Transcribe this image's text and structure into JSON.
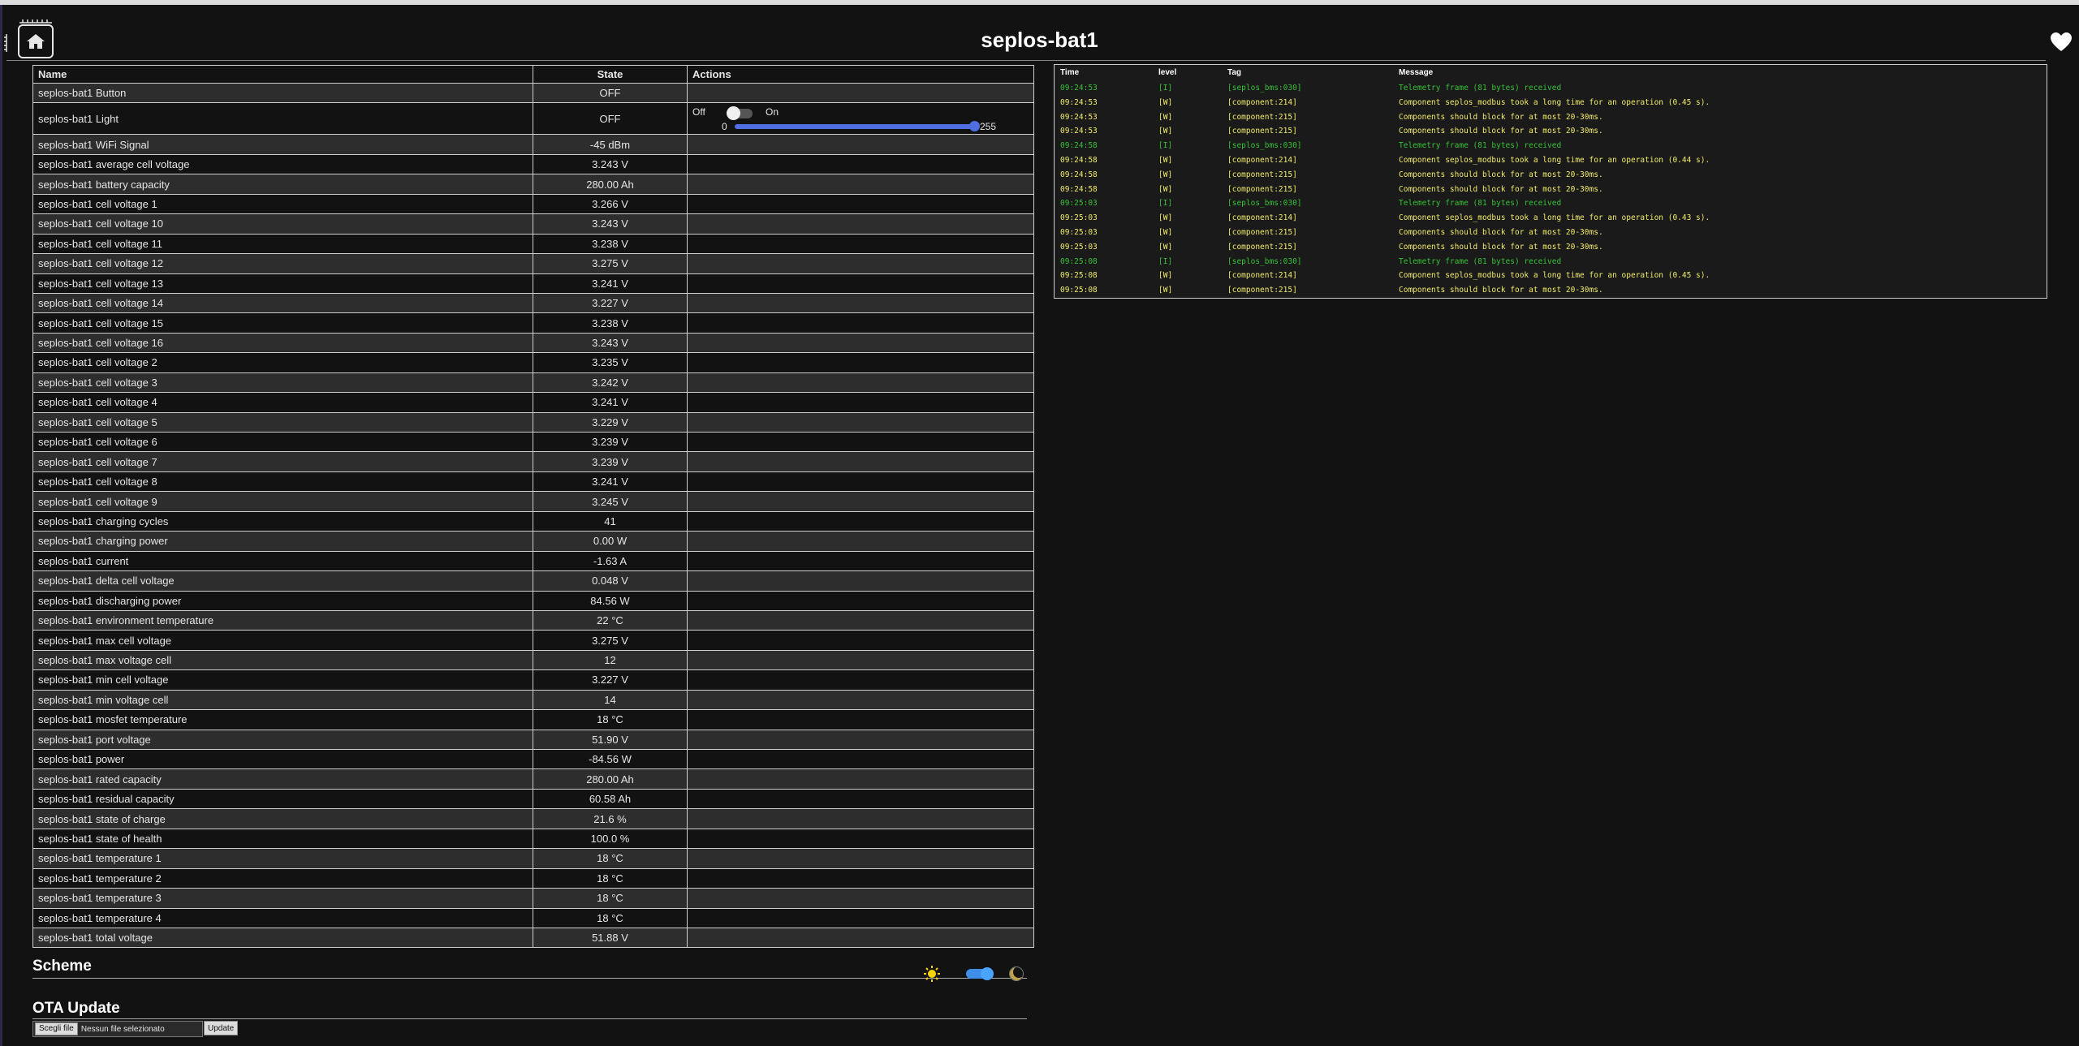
{
  "page": {
    "title": "seplos-bat1"
  },
  "table": {
    "headers": [
      "Name",
      "State",
      "Actions"
    ],
    "rows": [
      {
        "name": "seplos-bat1 Button",
        "state": "OFF"
      },
      {
        "name": "seplos-bat1 Light",
        "state": "OFF"
      },
      {
        "name": "seplos-bat1 WiFi Signal",
        "state": "-45 dBm"
      },
      {
        "name": "seplos-bat1 average cell voltage",
        "state": "3.243 V"
      },
      {
        "name": "seplos-bat1 battery capacity",
        "state": "280.00 Ah"
      },
      {
        "name": "seplos-bat1 cell voltage 1",
        "state": "3.266 V"
      },
      {
        "name": "seplos-bat1 cell voltage 10",
        "state": "3.243 V"
      },
      {
        "name": "seplos-bat1 cell voltage 11",
        "state": "3.238 V"
      },
      {
        "name": "seplos-bat1 cell voltage 12",
        "state": "3.275 V"
      },
      {
        "name": "seplos-bat1 cell voltage 13",
        "state": "3.241 V"
      },
      {
        "name": "seplos-bat1 cell voltage 14",
        "state": "3.227 V"
      },
      {
        "name": "seplos-bat1 cell voltage 15",
        "state": "3.238 V"
      },
      {
        "name": "seplos-bat1 cell voltage 16",
        "state": "3.243 V"
      },
      {
        "name": "seplos-bat1 cell voltage 2",
        "state": "3.235 V"
      },
      {
        "name": "seplos-bat1 cell voltage 3",
        "state": "3.242 V"
      },
      {
        "name": "seplos-bat1 cell voltage 4",
        "state": "3.241 V"
      },
      {
        "name": "seplos-bat1 cell voltage 5",
        "state": "3.229 V"
      },
      {
        "name": "seplos-bat1 cell voltage 6",
        "state": "3.239 V"
      },
      {
        "name": "seplos-bat1 cell voltage 7",
        "state": "3.239 V"
      },
      {
        "name": "seplos-bat1 cell voltage 8",
        "state": "3.241 V"
      },
      {
        "name": "seplos-bat1 cell voltage 9",
        "state": "3.245 V"
      },
      {
        "name": "seplos-bat1 charging cycles",
        "state": "41"
      },
      {
        "name": "seplos-bat1 charging power",
        "state": "0.00 W"
      },
      {
        "name": "seplos-bat1 current",
        "state": "-1.63 A"
      },
      {
        "name": "seplos-bat1 delta cell voltage",
        "state": "0.048 V"
      },
      {
        "name": "seplos-bat1 discharging power",
        "state": "84.56 W"
      },
      {
        "name": "seplos-bat1 environment temperature",
        "state": "22 °C"
      },
      {
        "name": "seplos-bat1 max cell voltage",
        "state": "3.275 V"
      },
      {
        "name": "seplos-bat1 max voltage cell",
        "state": "12"
      },
      {
        "name": "seplos-bat1 min cell voltage",
        "state": "3.227 V"
      },
      {
        "name": "seplos-bat1 min voltage cell",
        "state": "14"
      },
      {
        "name": "seplos-bat1 mosfet temperature",
        "state": "18 °C"
      },
      {
        "name": "seplos-bat1 port voltage",
        "state": "51.90 V"
      },
      {
        "name": "seplos-bat1 power",
        "state": "-84.56 W"
      },
      {
        "name": "seplos-bat1 rated capacity",
        "state": "280.00 Ah"
      },
      {
        "name": "seplos-bat1 residual capacity",
        "state": "60.58 Ah"
      },
      {
        "name": "seplos-bat1 state of charge",
        "state": "21.6 %"
      },
      {
        "name": "seplos-bat1 state of health",
        "state": "100.0 %"
      },
      {
        "name": "seplos-bat1 temperature 1",
        "state": "18 °C"
      },
      {
        "name": "seplos-bat1 temperature 2",
        "state": "18 °C"
      },
      {
        "name": "seplos-bat1 temperature 3",
        "state": "18 °C"
      },
      {
        "name": "seplos-bat1 temperature 4",
        "state": "18 °C"
      },
      {
        "name": "seplos-bat1 total voltage",
        "state": "51.88 V"
      }
    ]
  },
  "light_control": {
    "off_label": "Off",
    "on_label": "On",
    "min": "0",
    "max": "255",
    "brightness_fraction": 1.0,
    "switch_on": false
  },
  "log": {
    "headers": [
      "Time",
      "level",
      "Tag",
      "Message"
    ],
    "entries": [
      {
        "time": "09:24:53",
        "level": "[I]",
        "tag": "[seplos_bms:030]",
        "message": "Telemetry frame (81 bytes) received",
        "kind": "I"
      },
      {
        "time": "09:24:53",
        "level": "[W]",
        "tag": "[component:214]",
        "message": "Component seplos_modbus took a long time for an operation (0.45 s).",
        "kind": "W"
      },
      {
        "time": "09:24:53",
        "level": "[W]",
        "tag": "[component:215]",
        "message": "Components should block for at most 20-30ms.",
        "kind": "W"
      },
      {
        "time": "09:24:53",
        "level": "[W]",
        "tag": "[component:215]",
        "message": "Components should block for at most 20-30ms.",
        "kind": "W"
      },
      {
        "time": "09:24:58",
        "level": "[I]",
        "tag": "[seplos_bms:030]",
        "message": "Telemetry frame (81 bytes) received",
        "kind": "I"
      },
      {
        "time": "09:24:58",
        "level": "[W]",
        "tag": "[component:214]",
        "message": "Component seplos_modbus took a long time for an operation (0.44 s).",
        "kind": "W"
      },
      {
        "time": "09:24:58",
        "level": "[W]",
        "tag": "[component:215]",
        "message": "Components should block for at most 20-30ms.",
        "kind": "W"
      },
      {
        "time": "09:24:58",
        "level": "[W]",
        "tag": "[component:215]",
        "message": "Components should block for at most 20-30ms.",
        "kind": "W"
      },
      {
        "time": "09:25:03",
        "level": "[I]",
        "tag": "[seplos_bms:030]",
        "message": "Telemetry frame (81 bytes) received",
        "kind": "I"
      },
      {
        "time": "09:25:03",
        "level": "[W]",
        "tag": "[component:214]",
        "message": "Component seplos_modbus took a long time for an operation (0.43 s).",
        "kind": "W"
      },
      {
        "time": "09:25:03",
        "level": "[W]",
        "tag": "[component:215]",
        "message": "Components should block for at most 20-30ms.",
        "kind": "W"
      },
      {
        "time": "09:25:03",
        "level": "[W]",
        "tag": "[component:215]",
        "message": "Components should block for at most 20-30ms.",
        "kind": "W"
      },
      {
        "time": "09:25:08",
        "level": "[I]",
        "tag": "[seplos_bms:030]",
        "message": "Telemetry frame (81 bytes) received",
        "kind": "I"
      },
      {
        "time": "09:25:08",
        "level": "[W]",
        "tag": "[component:214]",
        "message": "Component seplos_modbus took a long time for an operation (0.45 s).",
        "kind": "W"
      },
      {
        "time": "09:25:08",
        "level": "[W]",
        "tag": "[component:215]",
        "message": "Components should block for at most 20-30ms.",
        "kind": "W"
      }
    ]
  },
  "scheme": {
    "title": "Scheme",
    "dark_mode": true
  },
  "ota": {
    "title": "OTA Update",
    "file_button_label": "Scegli file",
    "file_status": "Nessun file selezionato",
    "update_label": "Update"
  },
  "icons": {
    "home": "home-icon",
    "chip": "chip-icon",
    "favorite": "heart-icon",
    "light_scheme": "sun-icon",
    "dark_scheme": "moon-icon"
  },
  "colors": {
    "background": "#121212",
    "log_info": "#37c137",
    "log_warning": "#f1ec6a",
    "slider_accent": "#4f6fe0",
    "toggle_accent": "#3f8fe8",
    "sun": "#f5d300"
  }
}
